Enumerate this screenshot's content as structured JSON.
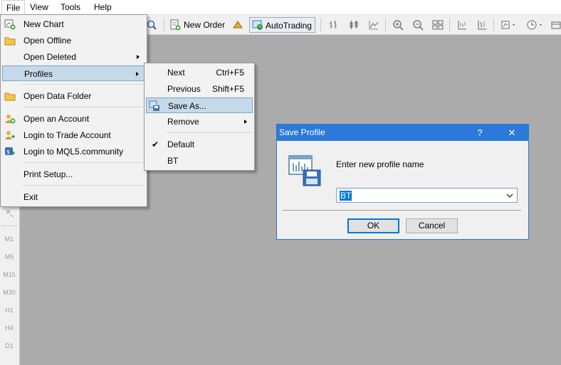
{
  "menubar": {
    "items": [
      {
        "label": "File"
      },
      {
        "label": "View"
      },
      {
        "label": "Tools"
      },
      {
        "label": "Help"
      }
    ]
  },
  "toolbar": {
    "new_order": "New Order",
    "autotrading": "AutoTrading"
  },
  "file_menu": {
    "items": [
      {
        "label": "New Chart",
        "icon": "new-chart-icon"
      },
      {
        "label": "Open Offline",
        "icon": "folder-icon"
      },
      {
        "label": "Open Deleted",
        "icon": ""
      },
      {
        "label": "Profiles",
        "icon": ""
      },
      {
        "label": "Open Data Folder",
        "icon": "folder-icon"
      },
      {
        "label": "Open an Account",
        "icon": "account-icon"
      },
      {
        "label": "Login to Trade Account",
        "icon": "login-icon"
      },
      {
        "label": "Login to MQL5.community",
        "icon": "mql5-icon"
      },
      {
        "label": "Print Setup...",
        "icon": ""
      },
      {
        "label": "Exit",
        "icon": ""
      }
    ]
  },
  "profiles_menu": {
    "items": [
      {
        "label": "Next",
        "shortcut": "Ctrl+F5"
      },
      {
        "label": "Previous",
        "shortcut": "Shift+F5"
      },
      {
        "label": "Save As...",
        "shortcut": ""
      },
      {
        "label": "Remove",
        "shortcut": ""
      },
      {
        "label": "Default",
        "shortcut": ""
      },
      {
        "label": "BT",
        "shortcut": ""
      }
    ]
  },
  "timeframes": [
    "M1",
    "M5",
    "M15",
    "M30",
    "H1",
    "H4",
    "D1"
  ],
  "dialog": {
    "title": "Save Profile",
    "help": "?",
    "close": "✕",
    "prompt": "Enter new profile name",
    "input_value": "BT",
    "ok_label": "OK",
    "cancel_label": "Cancel"
  },
  "colors": {
    "accent": "#2b79d8",
    "menu_highlight": "#c6d9ea",
    "workspace": "#ababab"
  }
}
